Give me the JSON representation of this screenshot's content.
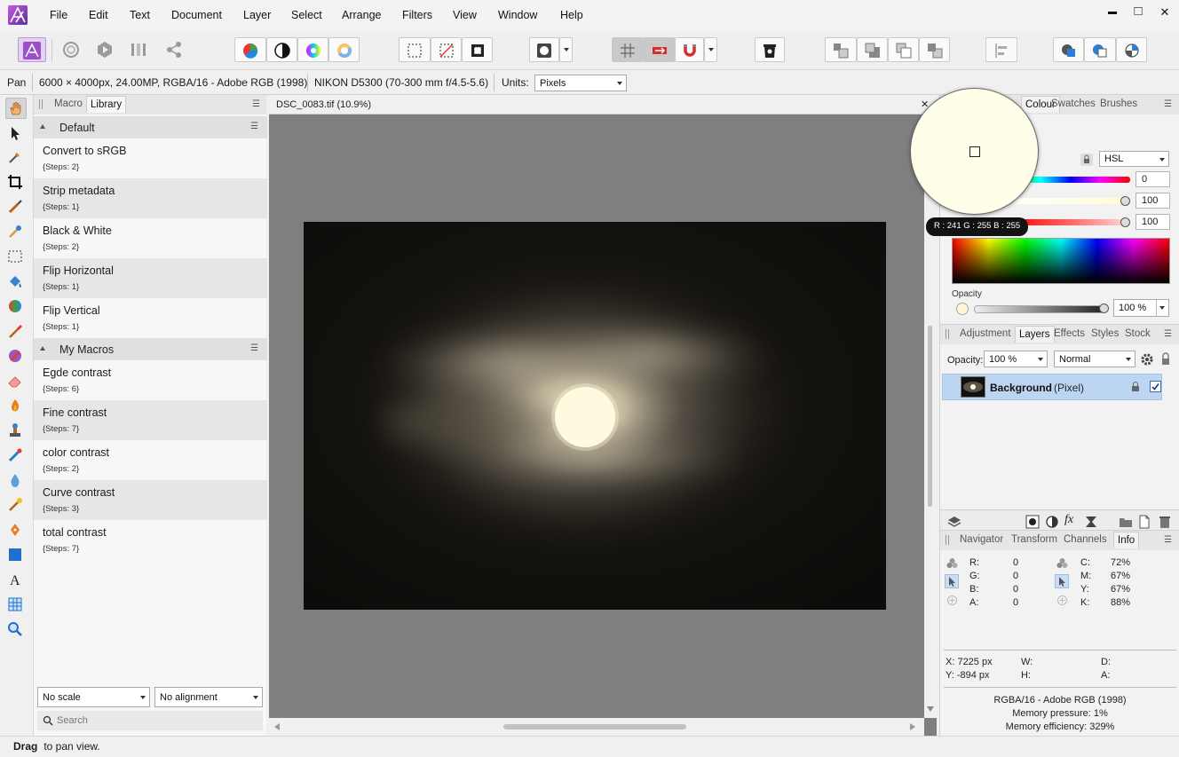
{
  "app": {
    "logo_name": "affinity-photo-logo"
  },
  "menu": [
    "File",
    "Edit",
    "Text",
    "Document",
    "Layer",
    "Select",
    "Arrange",
    "Filters",
    "View",
    "Window",
    "Help"
  ],
  "window_controls": {
    "minimize": "▬",
    "maximize": "□",
    "close": "✕"
  },
  "context_bar": {
    "tool": "Pan",
    "image_info": "6000 × 4000px, 24.00MP, RGBA/16 - Adobe RGB (1998)",
    "camera": "NIKON D5300 (70-300 mm f/4.5-5.6)",
    "units_label": "Units:",
    "units_value": "Pixels"
  },
  "macro_panel": {
    "tabs": [
      "Macro",
      "Library"
    ],
    "active_tab": "Library",
    "groups": [
      {
        "name": "Default",
        "items": [
          {
            "name": "Convert to sRGB",
            "steps": "{Steps: 2}"
          },
          {
            "name": "Strip metadata",
            "steps": "{Steps: 1}"
          },
          {
            "name": "Black & White",
            "steps": "{Steps: 2}"
          },
          {
            "name": "Flip Horizontal",
            "steps": "{Steps: 1}"
          },
          {
            "name": "Flip Vertical",
            "steps": "{Steps: 1}"
          }
        ]
      },
      {
        "name": "My Macros",
        "items": [
          {
            "name": "Egde contrast",
            "steps": "{Steps: 6}"
          },
          {
            "name": "Fine contrast",
            "steps": "{Steps: 7}"
          },
          {
            "name": "color contrast",
            "steps": "{Steps: 2}"
          },
          {
            "name": "Curve contrast",
            "steps": "{Steps: 3}"
          },
          {
            "name": "total contrast",
            "steps": "{Steps: 7}"
          }
        ]
      }
    ],
    "scale_value": "No scale",
    "alignment_value": "No alignment",
    "search_placeholder": "Search"
  },
  "document": {
    "tab_title": "DSC_0083.tif (10.9%)",
    "close": "✕"
  },
  "colour_panel": {
    "tabs": [
      "Colour",
      "Swatches",
      "Brushes"
    ],
    "active_tab": "Colour",
    "model": "HSL",
    "h": "0",
    "s": "100",
    "l": "100",
    "opacity_label": "Opacity",
    "opacity_value": "100 %"
  },
  "loupe": {
    "readout": "R : 241 G : 255 B : 255",
    "color": "#fffee8"
  },
  "layers_panel": {
    "tabs": [
      "Adjustment",
      "Layers",
      "Effects",
      "Styles",
      "Stock"
    ],
    "active_tab": "Layers",
    "opacity_label": "Opacity:",
    "opacity_value": "100 %",
    "blend_mode": "Normal",
    "layer_name": "Background",
    "layer_type": "(Pixel)"
  },
  "info_panel": {
    "tabs": [
      "Navigator",
      "Transform",
      "Channels",
      "Info"
    ],
    "active_tab": "Info",
    "rgba": [
      {
        "k": "R:",
        "v": "0"
      },
      {
        "k": "G:",
        "v": "0"
      },
      {
        "k": "B:",
        "v": "0"
      },
      {
        "k": "A:",
        "v": "0"
      }
    ],
    "cmyk": [
      {
        "k": "C:",
        "v": "72%"
      },
      {
        "k": "M:",
        "v": "67%"
      },
      {
        "k": "Y:",
        "v": "67%"
      },
      {
        "k": "K:",
        "v": "88%"
      }
    ],
    "x": "X: 7225 px",
    "y": "Y: -894 px",
    "w": "W:",
    "h": "H:",
    "d": "D:",
    "a": "A:",
    "color_profile": "RGBA/16 - Adobe RGB (1998)",
    "memory_pressure": "Memory pressure: 1%",
    "memory_efficiency": "Memory efficiency: 329%"
  },
  "status": {
    "bold": "Drag",
    "text": " to pan view."
  }
}
